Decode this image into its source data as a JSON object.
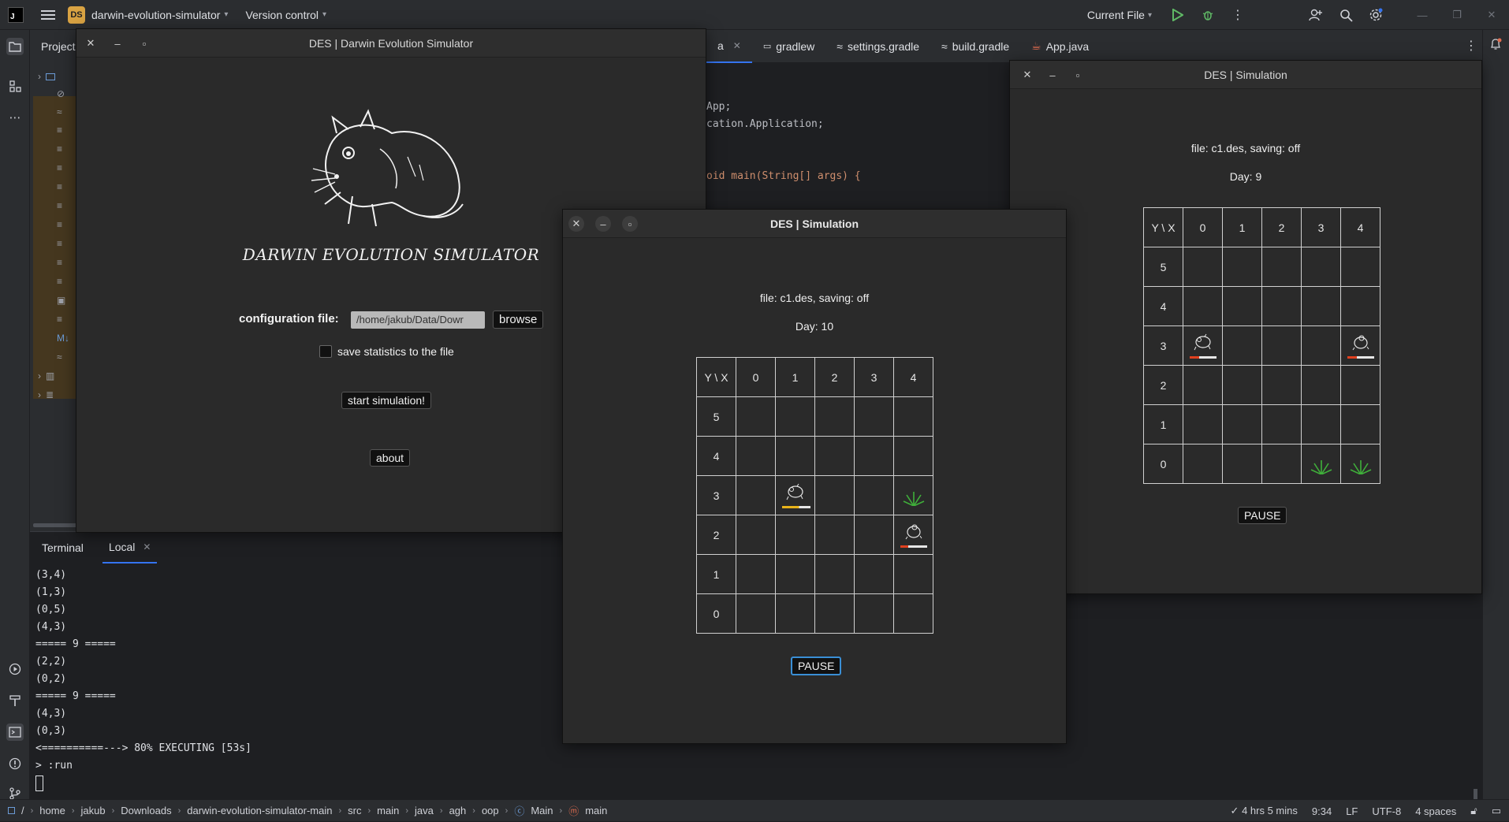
{
  "ide": {
    "logo": "J",
    "project_badge": "DS",
    "project_name": "darwin-evolution-simulator",
    "vcs_label": "Version control",
    "run_config": "Current File",
    "project_panel_title": "Project"
  },
  "editor": {
    "tabs": [
      {
        "label": "a",
        "active": true
      },
      {
        "label": "gradlew"
      },
      {
        "label": "settings.gradle"
      },
      {
        "label": "build.gradle"
      },
      {
        "label": "App.java"
      }
    ],
    "code": [
      "App;",
      "cation.Application;",
      "",
      "oid main(String[] args) {"
    ]
  },
  "terminal": {
    "title": "Terminal",
    "tab_label": "Local",
    "lines": [
      "(3,4)",
      "(1,3)",
      "(0,5)",
      "(4,3)",
      "===== 9 =====",
      "(2,2)",
      "(0,2)",
      "===== 9 =====",
      "(4,3)",
      "(0,3)",
      "<==========---> 80% EXECUTING [53s]",
      "> :run"
    ]
  },
  "statusbar": {
    "breadcrumb": [
      "home",
      "jakub",
      "Downloads",
      "darwin-evolution-simulator-main",
      "src",
      "main",
      "java",
      "agh",
      "oop",
      "Main",
      "main"
    ],
    "root": "/",
    "time_tracked": "4 hrs 5 mins",
    "position": "9:34",
    "line_ending": "LF",
    "encoding": "UTF-8",
    "indent": "4 spaces"
  },
  "main_window": {
    "title": "DES | Darwin Evolution Simulator",
    "app_name": "DARWIN EVOLUTION SIMULATOR",
    "config_label": "configuration file:",
    "config_value": "/home/jakub/Data/Dowr",
    "browse": "browse",
    "save_stats_label": "save statistics to the file",
    "start": "start simulation!",
    "about": "about"
  },
  "sim_front": {
    "title": "DES | Simulation",
    "file_info": "file: c1.des, saving: off",
    "day": "Day: 10",
    "corner": "Y \\ X",
    "cols": [
      "0",
      "1",
      "2",
      "3",
      "4"
    ],
    "rows": [
      "5",
      "4",
      "3",
      "2",
      "1",
      "0"
    ],
    "pause": "PAUSE"
  },
  "sim_back": {
    "title": "DES | Simulation",
    "file_info": "file: c1.des, saving: off",
    "day": "Day: 9",
    "corner": "Y \\ X",
    "cols": [
      "0",
      "1",
      "2",
      "3",
      "4"
    ],
    "rows": [
      "5",
      "4",
      "3",
      "2",
      "1",
      "0"
    ],
    "pause": "PAUSE"
  },
  "colors": {
    "energy_high": "#e8b31a",
    "energy_low": "#e0401f",
    "grass": "#3fae3a",
    "accent": "#3574f0"
  }
}
